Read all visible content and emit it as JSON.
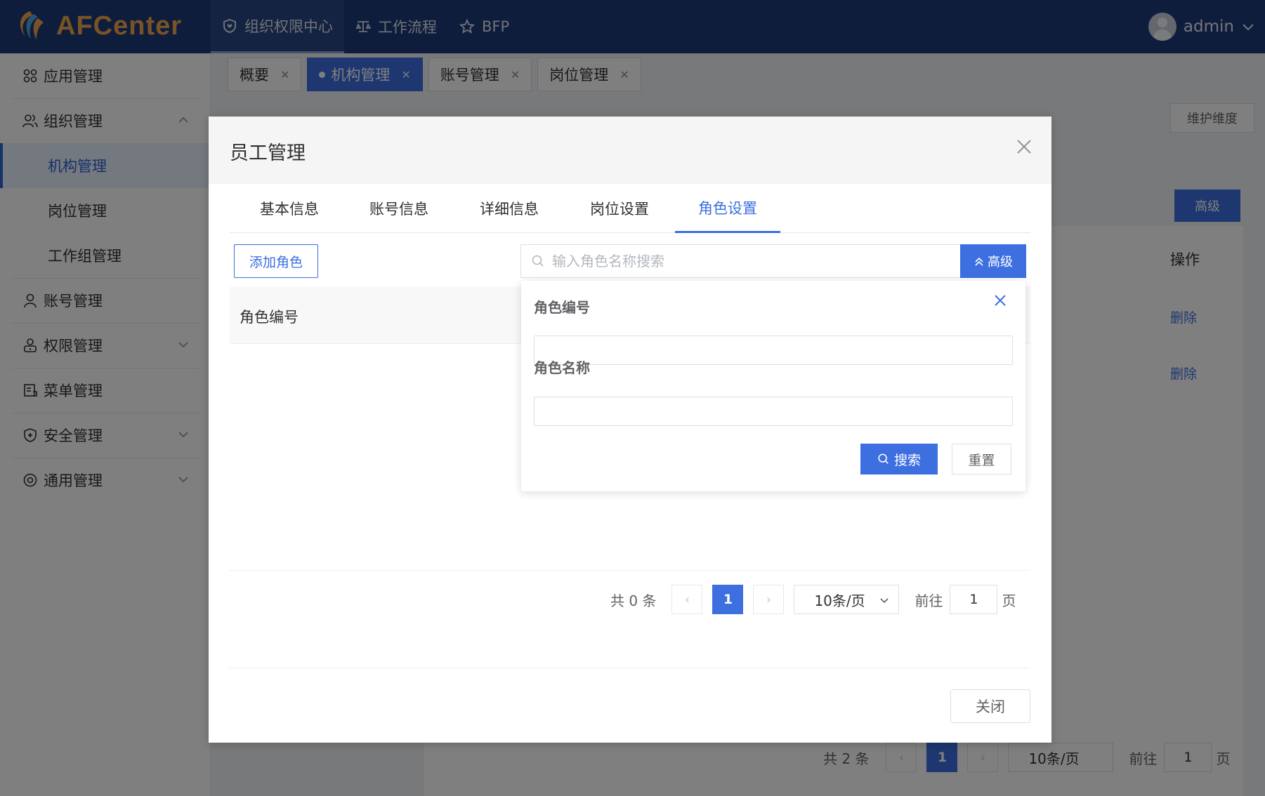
{
  "app": {
    "logo_text": "AFCenter"
  },
  "topnav": [
    {
      "label": "组织权限中心",
      "icon": "shield-heart-icon",
      "active": true
    },
    {
      "label": "工作流程",
      "icon": "workflow-icon",
      "active": false
    },
    {
      "label": "BFP",
      "icon": "star-icon",
      "active": false
    }
  ],
  "user": {
    "name": "admin"
  },
  "sidebar": {
    "items": [
      {
        "label": "应用管理",
        "icon": "apps-icon"
      },
      {
        "label": "组织管理",
        "icon": "users-icon"
      },
      {
        "label": "机构管理",
        "sub": true,
        "active": true
      },
      {
        "label": "岗位管理",
        "sub": true
      },
      {
        "label": "工作组管理",
        "sub": true
      },
      {
        "label": "账号管理",
        "icon": "user-icon"
      },
      {
        "label": "权限管理",
        "icon": "lock-user-icon"
      },
      {
        "label": "菜单管理",
        "icon": "menu-icon"
      },
      {
        "label": "安全管理",
        "icon": "security-icon"
      },
      {
        "label": "通用管理",
        "icon": "settings-icon"
      }
    ]
  },
  "page_tabs": [
    {
      "label": "概要",
      "active": false
    },
    {
      "label": "机构管理",
      "active": true
    },
    {
      "label": "账号管理",
      "active": false
    },
    {
      "label": "岗位管理",
      "active": false
    }
  ],
  "background": {
    "maintain_label": "维护维度",
    "advanced_label": "高级",
    "operation_header": "操作",
    "delete_label": "删除",
    "pager_total": "共 2 条",
    "pager_page": "1",
    "pager_size": "10条/页",
    "pager_goto": "前往",
    "pager_goto_value": "1",
    "pager_page_suffix": "页"
  },
  "dialog": {
    "title": "员工管理",
    "tabs": [
      "基本信息",
      "账号信息",
      "详细信息",
      "岗位设置",
      "角色设置"
    ],
    "active_tab": "角色设置",
    "add_role_label": "添加角色",
    "search_placeholder": "输入角色名称搜索",
    "advanced_label": "高级",
    "table_header_code": "角色编号",
    "popover": {
      "code_label": "角色编号",
      "name_label": "角色名称",
      "search_label": "搜索",
      "reset_label": "重置"
    },
    "pager": {
      "total": "共 0 条",
      "page": "1",
      "size": "10条/页",
      "goto": "前往",
      "goto_value": "1",
      "page_suffix": "页"
    },
    "close_label": "关闭"
  },
  "colors": {
    "header": "#1f3a7a",
    "primary": "#3d6fe0",
    "logo": "#f3a64a"
  }
}
